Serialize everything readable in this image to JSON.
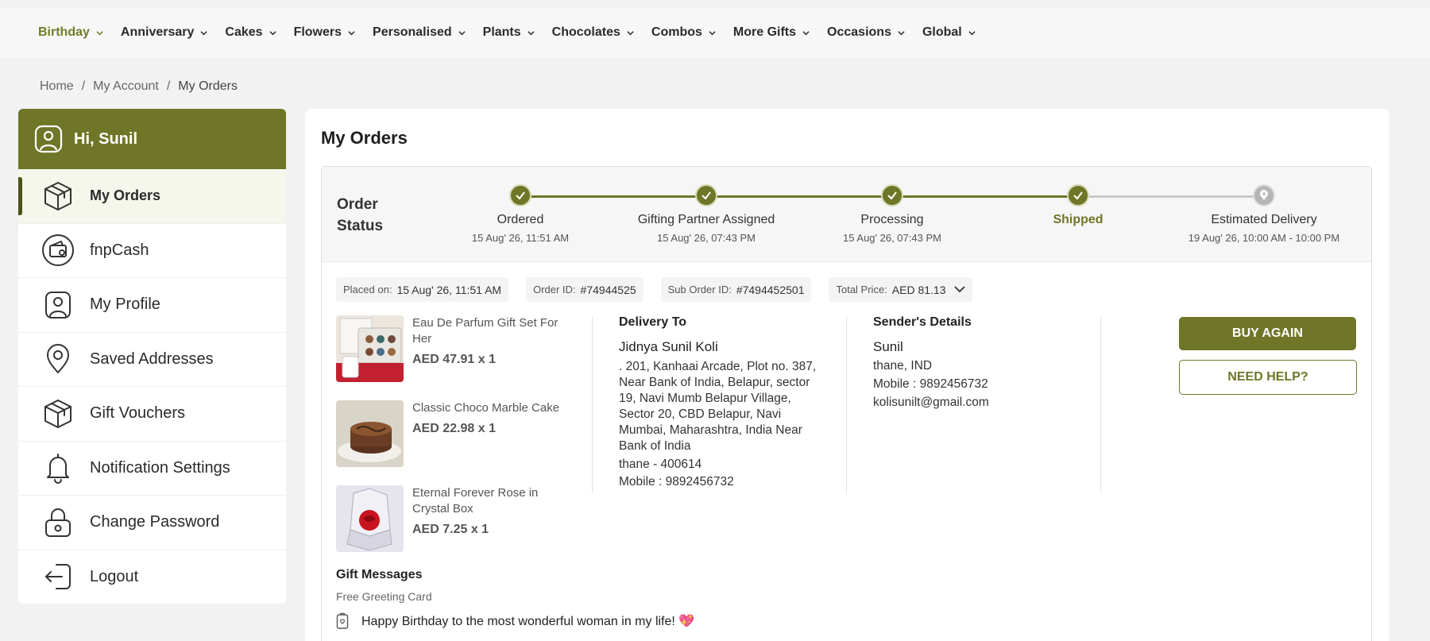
{
  "nav": {
    "items": [
      {
        "label": "Birthday",
        "active": true
      },
      {
        "label": "Anniversary"
      },
      {
        "label": "Cakes"
      },
      {
        "label": "Flowers"
      },
      {
        "label": "Personalised"
      },
      {
        "label": "Plants"
      },
      {
        "label": "Chocolates"
      },
      {
        "label": "Combos"
      },
      {
        "label": "More Gifts"
      },
      {
        "label": "Occasions"
      },
      {
        "label": "Global"
      }
    ]
  },
  "breadcrumb": {
    "home": "Home",
    "account": "My Account",
    "current": "My Orders",
    "separator": "/"
  },
  "sidebar": {
    "greeting": "Hi, Sunil",
    "items": [
      {
        "label": "My Orders",
        "icon": "box-icon",
        "active": true
      },
      {
        "label": "fnpCash",
        "icon": "wallet-icon"
      },
      {
        "label": "My Profile",
        "icon": "profile-icon"
      },
      {
        "label": "Saved Addresses",
        "icon": "location-pin-icon"
      },
      {
        "label": "Gift Vouchers",
        "icon": "voucher-box-icon"
      },
      {
        "label": "Notification Settings",
        "icon": "bell-icon"
      },
      {
        "label": "Change Password",
        "icon": "lock-icon"
      },
      {
        "label": "Logout",
        "icon": "logout-icon"
      }
    ]
  },
  "main": {
    "title": "My Orders",
    "order": {
      "status_label": "Order Status",
      "steps": [
        {
          "label": "Ordered",
          "time": "15 Aug' 26, 11:51 AM",
          "done": true
        },
        {
          "label": "Gifting Partner Assigned",
          "time": "15 Aug' 26, 07:43 PM",
          "done": true
        },
        {
          "label": "Processing",
          "time": "15 Aug' 26, 07:43 PM",
          "done": true
        },
        {
          "label": "Shipped",
          "time": "",
          "done": true,
          "current": true
        },
        {
          "label": "Estimated Delivery",
          "time": "19 Aug' 26, 10:00 AM - 10:00 PM",
          "done": false
        }
      ],
      "meta": {
        "placed_label": "Placed on:",
        "placed_value": "15 Aug' 26, 11:51 AM",
        "order_id_label": "Order ID:",
        "order_id_value": "#74944525",
        "sub_order_label": "Sub Order ID:",
        "sub_order_value": "#7494452501",
        "total_label": "Total Price:",
        "total_value": "AED 81.13"
      },
      "products": [
        {
          "name": "Eau De Parfum Gift Set For Her",
          "price": "AED 47.91",
          "qty": "x 1"
        },
        {
          "name": "Classic Choco Marble Cake",
          "price": "AED 22.98",
          "qty": "x 1"
        },
        {
          "name": "Eternal Forever Rose in Crystal Box",
          "price": "AED 7.25",
          "qty": "x 1"
        }
      ],
      "delivery": {
        "title": "Delivery To",
        "name": "Jidnya Sunil Koli",
        "address": ". 201, Kanhaai Arcade, Plot no. 387, Near Bank of India, Belapur, sector 19, Navi Mumb Belapur Village, Sector 20, CBD Belapur, Navi Mumbai, Maharashtra, India Near Bank of India",
        "city": "thane - 400614",
        "mobile": "Mobile : 9892456732"
      },
      "sender": {
        "title": "Sender's Details",
        "name": "Sunil",
        "location": "thane, IND",
        "mobile": "Mobile : 9892456732",
        "email": "kolisunilt@gmail.com"
      },
      "actions": {
        "buy_again": "BUY AGAIN",
        "need_help": "NEED HELP?"
      },
      "gift": {
        "title": "Gift Messages",
        "card_type": "Free Greeting Card",
        "message": "Happy Birthday to the most wonderful woman in my life! 💖"
      }
    }
  },
  "colors": {
    "brand": "#6f7628",
    "pending": "#b5b5b5"
  }
}
